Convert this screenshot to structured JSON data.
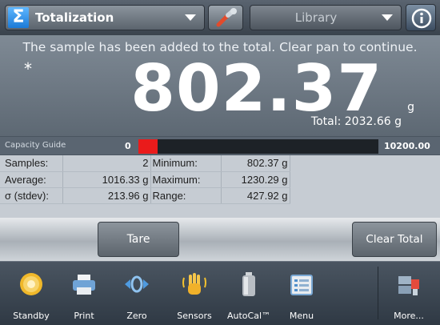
{
  "header": {
    "app_name": "Totalization",
    "library_label": "Library",
    "icons": {
      "app": "sigma-icon",
      "tool": "wrench-icon",
      "info": "info-icon"
    }
  },
  "display": {
    "message": "The sample has been added to the total.  Clear pan to continue.",
    "stable_marker": "*",
    "weight": "802.37",
    "unit": "g",
    "total": "Total: 2032.66 g"
  },
  "capacity_guide": {
    "label": "Capacity Guide",
    "min": "0",
    "max": "10200.00",
    "fill_fraction": 0.079,
    "fill_color": "#ea1b1b"
  },
  "stats": {
    "rows": [
      {
        "label": "Samples:",
        "value": "2",
        "label2": "Minimum:",
        "value2": "802.37 g"
      },
      {
        "label": "Average:",
        "value": "1016.33 g",
        "label2": "Maximum:",
        "value2": "1230.29 g"
      },
      {
        "label": "σ (stdev):",
        "value": "213.96 g",
        "label2": "Range:",
        "value2": "427.92 g"
      }
    ]
  },
  "actions": {
    "tare": "Tare",
    "clear_total": "Clear Total"
  },
  "nav": {
    "items": [
      {
        "label": "Standby",
        "icon": "standby-icon"
      },
      {
        "label": "Print",
        "icon": "printer-icon"
      },
      {
        "label": "Zero",
        "icon": "zero-icon"
      },
      {
        "label": "Sensors",
        "icon": "hand-sensor-icon"
      },
      {
        "label": "AutoCal™",
        "icon": "weight-icon"
      },
      {
        "label": "Menu",
        "icon": "menu-icon"
      },
      {
        "label": "More...",
        "icon": "more-icon"
      }
    ]
  }
}
